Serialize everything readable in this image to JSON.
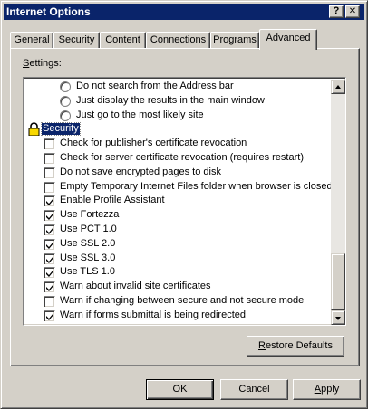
{
  "window": {
    "title": "Internet Options",
    "help_glyph": "?",
    "close_glyph": "✕"
  },
  "tabs": [
    {
      "label": "General",
      "active": false
    },
    {
      "label": "Security",
      "active": false
    },
    {
      "label": "Content",
      "active": false
    },
    {
      "label": "Connections",
      "active": false
    },
    {
      "label": "Programs",
      "active": false
    },
    {
      "label": "Advanced",
      "active": true
    }
  ],
  "settings": {
    "label_mnemonic": "S",
    "label_rest": "ettings:",
    "items": [
      {
        "kind": "radio",
        "label": "Do not search from the Address bar",
        "checked": false,
        "indent": 2
      },
      {
        "kind": "radio",
        "label": "Just display the results in the main window",
        "checked": false,
        "indent": 2
      },
      {
        "kind": "radio",
        "label": "Just go to the most likely site",
        "checked": false,
        "indent": 2
      },
      {
        "kind": "category",
        "label": "Security",
        "icon": "lock-icon",
        "selected": true
      },
      {
        "kind": "checkbox",
        "label": "Check for publisher's certificate revocation",
        "checked": false
      },
      {
        "kind": "checkbox",
        "label": "Check for server certificate revocation (requires restart)",
        "checked": false
      },
      {
        "kind": "checkbox",
        "label": "Do not save encrypted pages to disk",
        "checked": false
      },
      {
        "kind": "checkbox",
        "label": "Empty Temporary Internet Files folder when browser is closed",
        "checked": false
      },
      {
        "kind": "checkbox",
        "label": "Enable Profile Assistant",
        "checked": true
      },
      {
        "kind": "checkbox",
        "label": "Use Fortezza",
        "checked": true
      },
      {
        "kind": "checkbox",
        "label": "Use PCT 1.0",
        "checked": true
      },
      {
        "kind": "checkbox",
        "label": "Use SSL 2.0",
        "checked": true
      },
      {
        "kind": "checkbox",
        "label": "Use SSL 3.0",
        "checked": true
      },
      {
        "kind": "checkbox",
        "label": "Use TLS 1.0",
        "checked": true
      },
      {
        "kind": "checkbox",
        "label": "Warn about invalid site certificates",
        "checked": true
      },
      {
        "kind": "checkbox",
        "label": "Warn if changing between secure and not secure mode",
        "checked": false
      },
      {
        "kind": "checkbox",
        "label": "Warn if forms submittal is being redirected",
        "checked": true
      }
    ]
  },
  "buttons": {
    "restore_mnemonic": "R",
    "restore_rest": "estore Defaults",
    "ok": "OK",
    "cancel": "Cancel",
    "apply_mnemonic": "A",
    "apply_rest": "pply"
  },
  "colors": {
    "face": "#d4d0c8",
    "titlebar": "#0a246a",
    "selection": "#0a246a"
  }
}
